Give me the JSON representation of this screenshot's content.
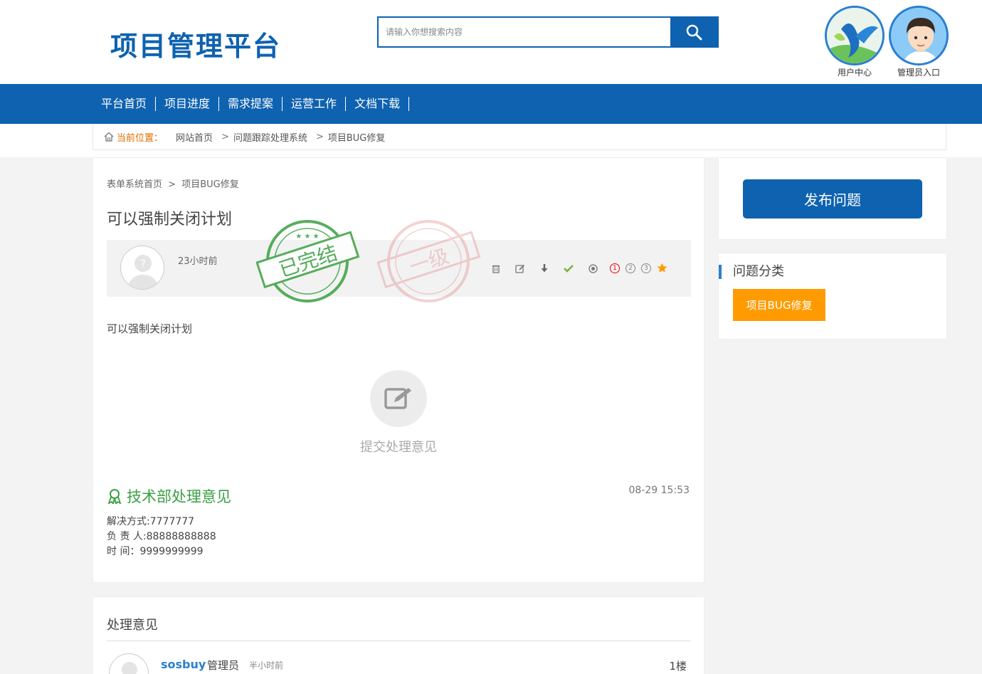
{
  "header": {
    "logo": "项目管理平台",
    "search_placeholder": "请输入你想搜索内容",
    "user_center": "用户中心",
    "admin_entry": "管理员入口"
  },
  "nav": {
    "items": [
      "平台首页",
      "项目进度",
      "需求提案",
      "运营工作",
      "文档下载"
    ]
  },
  "breadcrumb": {
    "here_label": "当前位置：",
    "items": [
      "网站首页",
      "问题跟踪处理系统",
      "项目BUG修复"
    ],
    "separator": ">"
  },
  "issue": {
    "sub_crumb_home": "表单系统首页",
    "sub_crumb_sep": ">",
    "sub_crumb_current": "项目BUG修复",
    "title": "可以强制关闭计划",
    "posted": "23小时前",
    "stamp_done": "已完结",
    "stamp_level": "一级",
    "priority": [
      "1",
      "2",
      "3"
    ],
    "content": "可以强制关闭计划",
    "submit_opinion": "提交处理意见"
  },
  "dept": {
    "label": "技术部处理意见",
    "time": "08-29 15:53",
    "method": "解决方式:7777777",
    "owner": "负 责 人:88888888888",
    "date": "时 间：9999999999"
  },
  "comments": {
    "heading": "处理意见",
    "user": "sosbuy",
    "role": "管理员",
    "time": "半小时前",
    "floor": "1楼"
  },
  "sidebar": {
    "publish": "发布问题",
    "category_heading": "问题分类",
    "category": "项目BUG修复"
  },
  "colors": {
    "brand": "#0e62b0",
    "orange": "#ff9b00",
    "green": "#3aa043"
  }
}
